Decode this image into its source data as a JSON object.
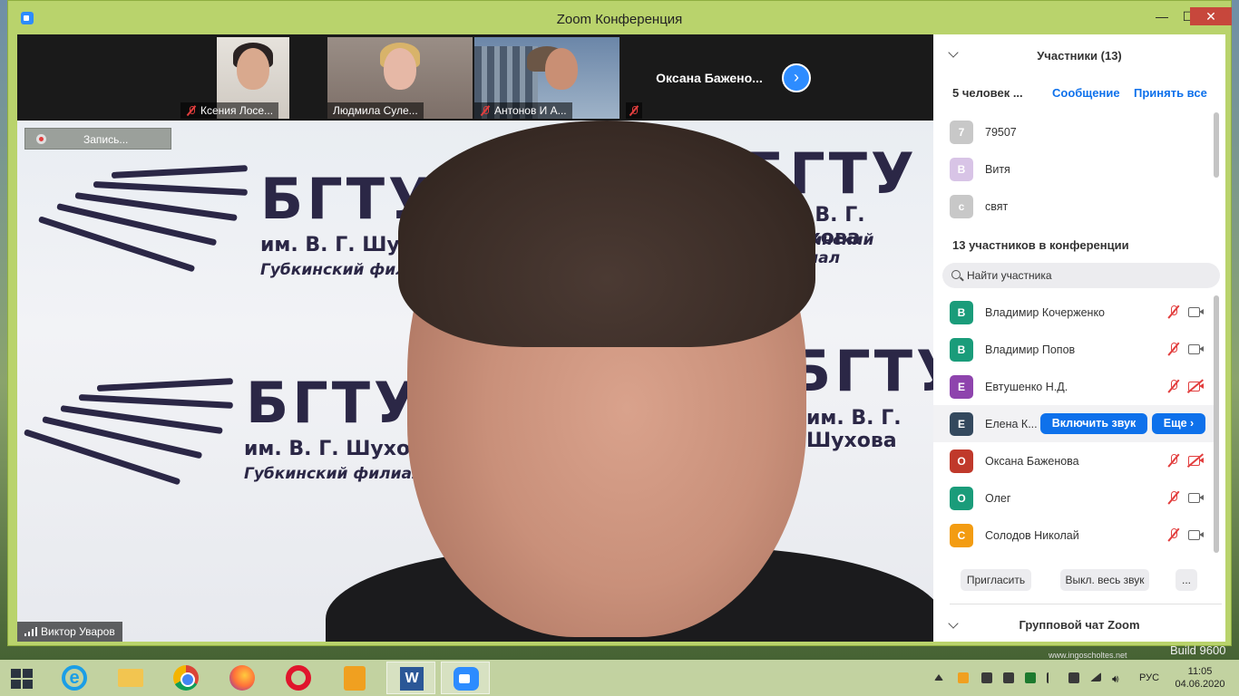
{
  "window": {
    "title": "Zoom Конференция",
    "minimize": "—",
    "maximize": "☐",
    "close": "✕"
  },
  "thumbnails": [
    {
      "name": "Ксения Лосе...",
      "muted": true
    },
    {
      "name": "Людмила Суле...",
      "muted": false
    },
    {
      "name": "Антонов И А...",
      "muted": true
    },
    {
      "name": "",
      "muted": true
    }
  ],
  "thumbnail_name_only": "Оксана  Баженo...",
  "next_arrow": "›",
  "video": {
    "recording_label": "Запись...",
    "speaker_name": "Виктор Уваров",
    "logo_lines": [
      "БГТУ",
      "им. В. Г. Шухова",
      "Губкинский филиал"
    ]
  },
  "panel": {
    "title": "Участники (13)",
    "waiting_count": "5 человек ...",
    "message_label": "Сообщение",
    "admit_all_label": "Принять все",
    "waiting": [
      {
        "initial": "7",
        "name": "79507",
        "color": "#c8c8c8"
      },
      {
        "initial": "В",
        "name": "Витя",
        "color": "#d8c4e6"
      },
      {
        "initial": "с",
        "name": "свят",
        "color": "#c8c8c8"
      }
    ],
    "in_conference_label": "13 участников в конференции",
    "search_placeholder": "Найти участника",
    "participants": [
      {
        "initial": "В",
        "name": "Владимир Кочерженко",
        "color": "#1a9c7a",
        "cam_off": false
      },
      {
        "initial": "В",
        "name": "Владимир Попов",
        "color": "#1a9c7a",
        "cam_off": false
      },
      {
        "initial": "Е",
        "name": "Евтушенко Н.Д.",
        "color": "#8e44ad",
        "cam_off": true
      },
      {
        "initial": "Е",
        "name": "Елена К...",
        "color": "#34495e",
        "cam_off": false
      },
      {
        "initial": "О",
        "name": "Оксана Баженова",
        "color": "#c0392b",
        "cam_off": true
      },
      {
        "initial": "О",
        "name": "Олег",
        "color": "#1a9c7a",
        "cam_off": false
      },
      {
        "initial": "С",
        "name": "Солодов Николай",
        "color": "#f39c12",
        "cam_off": false
      }
    ],
    "unmute_label": "Включить звук",
    "more_label": "Еще ›",
    "invite_label": "Пригласить",
    "mute_all_label": "Выкл. весь звук",
    "ellipsis_label": "...",
    "group_chat_label": "Групповой чат Zoom"
  },
  "taskbar": {
    "language": "РУС",
    "time": "11:05",
    "date": "04.06.2020",
    "word_letter": "W"
  },
  "desktop": {
    "build_text": "Build 9600",
    "watermark": "www.ingoscholtes.net"
  },
  "colors": {
    "accent": "#0e71eb",
    "zoom_blue": "#2d8cff",
    "muted_red": "#e23e3e",
    "titlebar": "#b9d36c"
  }
}
